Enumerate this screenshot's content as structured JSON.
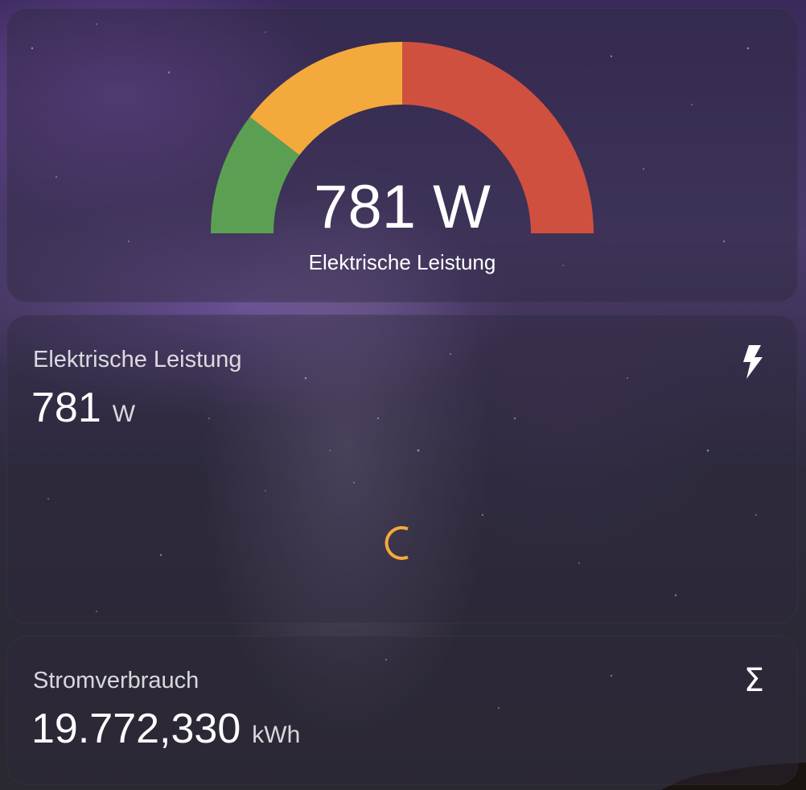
{
  "gauge": {
    "value_text": "781 W",
    "label": "Elektrische Leistung",
    "segment_colors": [
      "#5ba052",
      "#f4a93c",
      "#d0503f"
    ]
  },
  "power_card": {
    "title": "Elektrische Leistung",
    "value": "781",
    "unit": "W",
    "icon": "flash-icon",
    "loading_color": "#f4a93c"
  },
  "energy_card": {
    "title": "Stromverbrauch",
    "value": "19.772,330",
    "unit": "kWh",
    "icon": "sigma-icon"
  }
}
